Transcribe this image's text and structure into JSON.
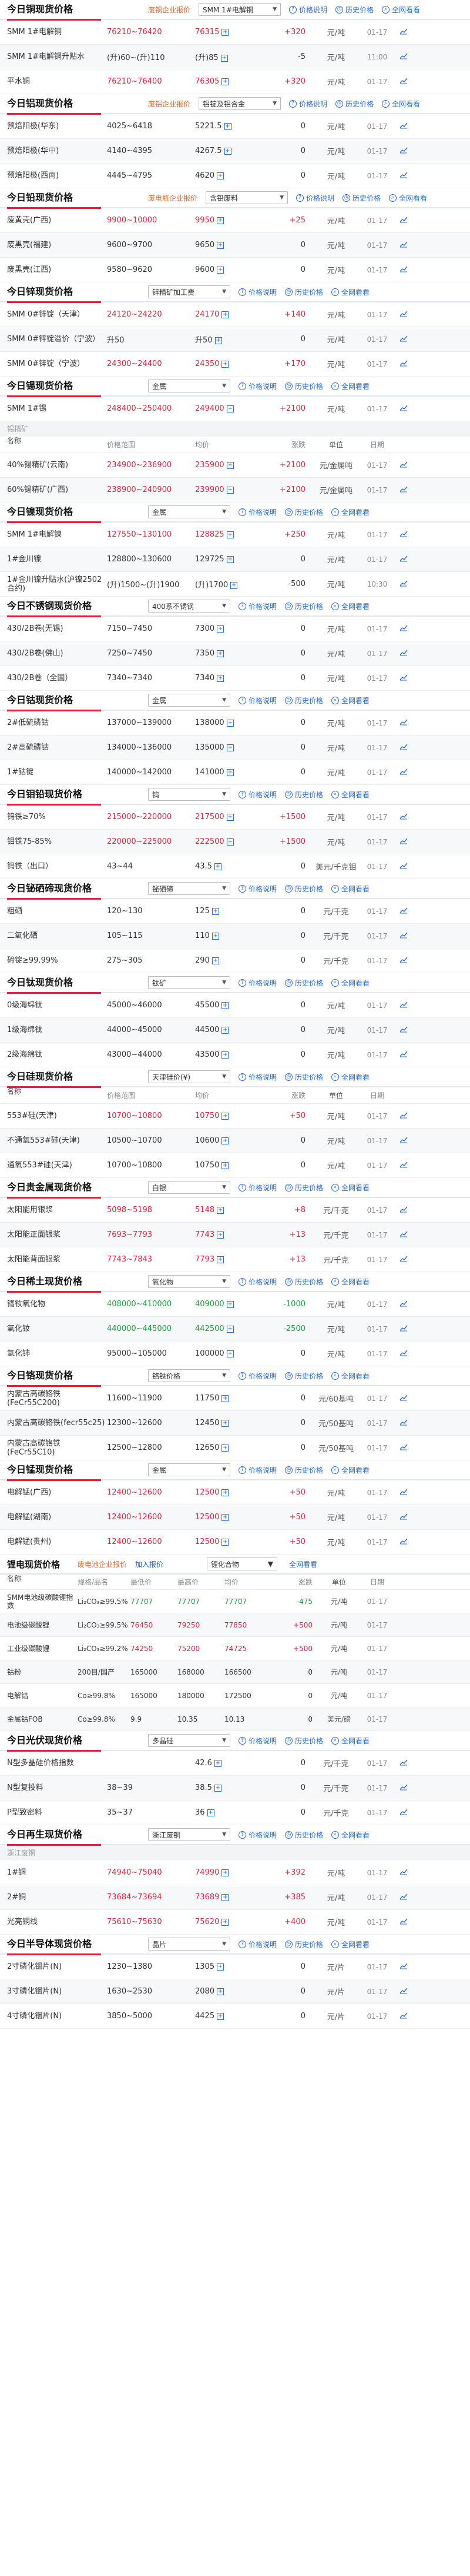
{
  "common": {
    "price_note": "价格说明",
    "history": "历史价格",
    "subscribe": "全网看看",
    "yuan_ton": "元/吨",
    "yuan_kg": "元/千克",
    "yuan_lv": "元/吨度",
    "usd_ton_kg": "美元/千克",
    "cols": {
      "name": "名称",
      "range": "价格范围",
      "avg": "均价",
      "chg": "涨跌",
      "unit": "单位",
      "date": "日期"
    }
  },
  "colors": {
    "accent": "#d7263d",
    "up": "#d7263d",
    "down": "#1a9c3e",
    "link": "#2a6bd6",
    "tag": "#e06a2c"
  },
  "sections": [
    {
      "title": "今日铜现货价格",
      "tag": "废铜企业报价",
      "select": "SMM 1#电解铜",
      "rows": [
        {
          "name": "SMM 1#电解铜",
          "range": "76210~76420",
          "avg": "76315",
          "chg": "+320",
          "dir": "up",
          "unit": "元/吨",
          "date": "01-17"
        },
        {
          "name": "SMM 1#电解铜升贴水",
          "range": "(升)60~(升)110",
          "avg": "(升)85",
          "chg": "-5",
          "dir": "none",
          "unit": "元/吨",
          "date": "11:00"
        },
        {
          "name": "平水铜",
          "range": "76210~76400",
          "avg": "76305",
          "chg": "+320",
          "dir": "up",
          "unit": "元/吨",
          "date": "01-17"
        }
      ]
    },
    {
      "title": "今日铝现货价格",
      "tag": "废铝企业报价",
      "select": "铝锭及铝合金",
      "rows": [
        {
          "name": "预焙阳极(华东)",
          "range": "4025~6418",
          "avg": "5221.5",
          "chg": "0",
          "dir": "none",
          "unit": "元/吨",
          "date": "01-17"
        },
        {
          "name": "预焙阳极(华中)",
          "range": "4140~4395",
          "avg": "4267.5",
          "chg": "0",
          "dir": "none",
          "unit": "元/吨",
          "date": "01-17"
        },
        {
          "name": "预焙阳极(西南)",
          "range": "4445~4795",
          "avg": "4620",
          "chg": "0",
          "dir": "none",
          "unit": "元/吨",
          "date": "01-17"
        }
      ]
    },
    {
      "title": "今日铅现货价格",
      "tag": "废电瓶企业报价",
      "select": "含铅废料",
      "rows": [
        {
          "name": "废黄壳(广西)",
          "range": "9900~10000",
          "avg": "9950",
          "chg": "+25",
          "dir": "up",
          "unit": "元/吨",
          "date": "01-17"
        },
        {
          "name": "废黑壳(福建)",
          "range": "9600~9700",
          "avg": "9650",
          "chg": "0",
          "dir": "none",
          "unit": "元/吨",
          "date": "01-17"
        },
        {
          "name": "废黑壳(江西)",
          "range": "9580~9620",
          "avg": "9600",
          "chg": "0",
          "dir": "none",
          "unit": "元/吨",
          "date": "01-17"
        }
      ]
    },
    {
      "title": "今日锌现货价格",
      "tag": "",
      "select": "锌精矿加工费",
      "rows": [
        {
          "name": "SMM 0#锌锭（天津）",
          "range": "24120~24220",
          "avg": "24170",
          "chg": "+140",
          "dir": "up",
          "unit": "元/吨",
          "date": "01-17"
        },
        {
          "name": "SMM 0#锌锭溢价（宁波）",
          "range": "升50",
          "avg": "升50",
          "chg": "0",
          "dir": "none",
          "unit": "元/吨",
          "date": "01-17"
        },
        {
          "name": "SMM 0#锌锭（宁波）",
          "range": "24300~24400",
          "avg": "24350",
          "chg": "+170",
          "dir": "up",
          "unit": "元/吨",
          "date": "01-17"
        }
      ]
    },
    {
      "title": "今日锡现货价格",
      "tag": "",
      "select": "金属",
      "rows": [
        {
          "name": "SMM 1#锡",
          "range": "248400~250400",
          "avg": "249400",
          "chg": "+2100",
          "dir": "up",
          "unit": "元/吨",
          "date": "01-17"
        }
      ],
      "subhead": "锡精矿",
      "rows2": [
        {
          "name": "40%锡精矿(云南)",
          "range": "234900~236900",
          "avg": "235900",
          "chg": "+2100",
          "dir": "up",
          "unit": "元/金属吨",
          "date": "01-17"
        },
        {
          "name": "60%锡精矿(广西)",
          "range": "238900~240900",
          "avg": "239900",
          "chg": "+2100",
          "dir": "up",
          "unit": "元/金属吨",
          "date": "01-17"
        }
      ]
    },
    {
      "title": "今日镍现货价格",
      "tag": "",
      "select": "金属",
      "rows": [
        {
          "name": "SMM 1#电解镍",
          "range": "127550~130100",
          "avg": "128825",
          "chg": "+250",
          "dir": "up",
          "unit": "元/吨",
          "date": "01-17"
        },
        {
          "name": "1#金川镍",
          "range": "128800~130600",
          "avg": "129725",
          "chg": "0",
          "dir": "none",
          "unit": "元/吨",
          "date": "01-17"
        },
        {
          "name": "1#金川镍升贴水(沪镍2502合约)",
          "range": "(升)1500~(升)1900",
          "avg": "(升)1700",
          "chg": "-500",
          "dir": "none",
          "unit": "元/吨",
          "date": "10:30"
        }
      ]
    },
    {
      "title": "今日不锈钢现货价格",
      "tag": "",
      "select": "400系不锈钢",
      "rows": [
        {
          "name": "430/2B卷(无锡)",
          "range": "7150~7450",
          "avg": "7300",
          "chg": "0",
          "dir": "none",
          "unit": "元/吨",
          "date": "01-17"
        },
        {
          "name": "430/2B卷(佛山)",
          "range": "7250~7450",
          "avg": "7350",
          "chg": "0",
          "dir": "none",
          "unit": "元/吨",
          "date": "01-17"
        },
        {
          "name": "430/2B卷（全国）",
          "range": "7340~7340",
          "avg": "7340",
          "chg": "0",
          "dir": "none",
          "unit": "元/吨",
          "date": "01-17"
        }
      ]
    },
    {
      "title": "今日钴现货价格",
      "tag": "",
      "select": "金属",
      "rows": [
        {
          "name": "2#低硫磷钴",
          "range": "137000~139000",
          "avg": "138000",
          "chg": "0",
          "dir": "none",
          "unit": "元/吨",
          "date": "01-17"
        },
        {
          "name": "2#高硫磷钴",
          "range": "134000~136000",
          "avg": "135000",
          "chg": "0",
          "dir": "none",
          "unit": "元/吨",
          "date": "01-17"
        },
        {
          "name": "1#钴锭",
          "range": "140000~142000",
          "avg": "141000",
          "chg": "0",
          "dir": "none",
          "unit": "元/吨",
          "date": "01-17"
        }
      ]
    },
    {
      "title": "今日钼铅现货价格",
      "tag": "",
      "select": "钨",
      "rows": [
        {
          "name": "钨铁≥70%",
          "range": "215000~220000",
          "avg": "217500",
          "chg": "+1500",
          "dir": "up",
          "unit": "元/吨",
          "date": "01-17"
        },
        {
          "name": "钼铁75-85%",
          "range": "220000~225000",
          "avg": "222500",
          "chg": "+1500",
          "dir": "up",
          "unit": "元/吨",
          "date": "01-17"
        },
        {
          "name": "钨铁（出口）",
          "range": "43~44",
          "avg": "43.5",
          "chg": "0",
          "dir": "none",
          "unit": "美元/千克钼",
          "date": "01-17"
        }
      ]
    },
    {
      "title": "今日铋硒碲现货价格",
      "tag": "",
      "select": "铋硒碲",
      "rows": [
        {
          "name": "粗硒",
          "range": "120~130",
          "avg": "125",
          "chg": "0",
          "dir": "none",
          "unit": "元/千克",
          "date": "01-17"
        },
        {
          "name": "二氧化硒",
          "range": "105~115",
          "avg": "110",
          "chg": "0",
          "dir": "none",
          "unit": "元/千克",
          "date": "01-17"
        },
        {
          "name": "碲锭≥99.99%",
          "range": "275~305",
          "avg": "290",
          "chg": "0",
          "dir": "none",
          "unit": "元/千克",
          "date": "01-17"
        }
      ]
    },
    {
      "title": "今日钛现货价格",
      "tag": "",
      "select": "钛矿",
      "rows": [
        {
          "name": "0级海绵钛",
          "range": "45000~46000",
          "avg": "45500",
          "chg": "0",
          "dir": "none",
          "unit": "元/吨",
          "date": "01-17"
        },
        {
          "name": "1级海绵钛",
          "range": "44000~45000",
          "avg": "44500",
          "chg": "0",
          "dir": "none",
          "unit": "元/吨",
          "date": "01-17"
        },
        {
          "name": "2级海绵钛",
          "range": "43000~44000",
          "avg": "43500",
          "chg": "0",
          "dir": "none",
          "unit": "元/吨",
          "date": "01-17"
        }
      ]
    },
    {
      "title": "今日硅现货价格",
      "tag": "",
      "select": "天津硅价(¥)",
      "rows": [
        {
          "name": "553#硅(天津)",
          "range": "10700~10800",
          "avg": "10750",
          "chg": "+50",
          "dir": "up",
          "unit": "元/吨",
          "date": "01-17"
        },
        {
          "name": "不通氧553#硅(天津)",
          "range": "10500~10700",
          "avg": "10600",
          "chg": "0",
          "dir": "none",
          "unit": "元/吨",
          "date": "01-17"
        },
        {
          "name": "通氧553#硅(天津)",
          "range": "10700~10800",
          "avg": "10750",
          "chg": "0",
          "dir": "none",
          "unit": "元/吨",
          "date": "01-17"
        }
      ],
      "with_colhead": true
    },
    {
      "title": "今日贵金属现货价格",
      "tag": "",
      "select": "白银",
      "rows": [
        {
          "name": "太阳能用银浆",
          "range": "5098~5198",
          "avg": "5148",
          "chg": "+8",
          "dir": "up",
          "unit": "元/千克",
          "date": "01-17"
        },
        {
          "name": "太阳能正面银浆",
          "range": "7693~7793",
          "avg": "7743",
          "chg": "+13",
          "dir": "up",
          "unit": "元/千克",
          "date": "01-17"
        },
        {
          "name": "太阳能背面银浆",
          "range": "7743~7843",
          "avg": "7793",
          "chg": "+13",
          "dir": "up",
          "unit": "元/千克",
          "date": "01-17"
        }
      ]
    },
    {
      "title": "今日稀土现货价格",
      "tag": "",
      "select": "氧化物",
      "rows": [
        {
          "name": "镨钕氧化物",
          "range": "408000~410000",
          "avg": "409000",
          "chg": "-1000",
          "dir": "down",
          "unit": "元/吨",
          "date": "01-17"
        },
        {
          "name": "氧化钕",
          "range": "440000~445000",
          "avg": "442500",
          "chg": "-2500",
          "dir": "down",
          "unit": "元/吨",
          "date": "01-17"
        },
        {
          "name": "氧化铈",
          "range": "95000~105000",
          "avg": "100000",
          "chg": "0",
          "dir": "none",
          "unit": "元/吨",
          "date": "01-17"
        }
      ]
    },
    {
      "title": "今日铬现货价格",
      "tag": "",
      "select": "铬铁价格",
      "rows": [
        {
          "name": "内蒙古高碳铬铁(FeCr55C200)",
          "range": "11600~11900",
          "avg": "11750",
          "chg": "0",
          "dir": "none",
          "unit": "元/60基吨",
          "date": "01-17"
        },
        {
          "name": "内蒙古高碳铬铁(fecr55c25)",
          "range": "12300~12600",
          "avg": "12450",
          "chg": "0",
          "dir": "none",
          "unit": "元/50基吨",
          "date": "01-17"
        },
        {
          "name": "内蒙古高碳铬铁(FeCr55C10)",
          "range": "12500~12800",
          "avg": "12650",
          "chg": "0",
          "dir": "none",
          "unit": "元/50基吨",
          "date": "01-17"
        }
      ]
    },
    {
      "title": "今日锰现货价格",
      "tag": "",
      "select": "金属",
      "rows": [
        {
          "name": "电解锰(广西)",
          "range": "12400~12600",
          "avg": "12500",
          "chg": "+50",
          "dir": "up",
          "unit": "元/吨",
          "date": "01-17"
        },
        {
          "name": "电解锰(湖南)",
          "range": "12400~12600",
          "avg": "12500",
          "chg": "+50",
          "dir": "up",
          "unit": "元/吨",
          "date": "01-17"
        },
        {
          "name": "电解锰(贵州)",
          "range": "12400~12600",
          "avg": "12500",
          "chg": "+50",
          "dir": "up",
          "unit": "元/吨",
          "date": "01-17"
        }
      ]
    }
  ],
  "lithium": {
    "title": "锂电现货价格",
    "tab1": "废电池企业报价",
    "tab2": "加入报价",
    "select": "锂化合物",
    "search": "全网看看",
    "cols": [
      "名称",
      "规格/品名",
      "最低价",
      "最高价",
      "均价",
      "涨跌",
      "单位",
      "日期"
    ],
    "rows": [
      {
        "name": "SMM电池级碳酸锂指数",
        "spec": "Li₂CO₃≥99.5%",
        "low": "77707",
        "high": "77707",
        "avg": "77707",
        "chg": "-475",
        "dir": "down",
        "unit": "元/吨",
        "date": "01-17"
      },
      {
        "name": "电池级碳酸锂",
        "spec": "Li₂CO₃≥99.5%",
        "low": "76450",
        "high": "79250",
        "avg": "77850",
        "chg": "+500",
        "dir": "up",
        "unit": "元/吨",
        "date": "01-17"
      },
      {
        "name": "工业级碳酸锂",
        "spec": "Li₂CO₃≥99.2%",
        "low": "74250",
        "high": "75200",
        "avg": "74725",
        "chg": "+500",
        "dir": "up",
        "unit": "元/吨",
        "date": "01-17"
      },
      {
        "name": "钴粉",
        "spec": "200目/国产",
        "low": "165000",
        "high": "168000",
        "avg": "166500",
        "chg": "0",
        "dir": "none",
        "unit": "元/吨",
        "date": "01-17"
      },
      {
        "name": "电解钴",
        "spec": "Co≥99.8%",
        "low": "165000",
        "high": "180000",
        "avg": "172500",
        "chg": "0",
        "dir": "none",
        "unit": "元/吨",
        "date": "01-17"
      },
      {
        "name": "金属钴FOB",
        "spec": "Co≥99.8%",
        "low": "9.9",
        "high": "10.35",
        "avg": "10.13",
        "chg": "0",
        "dir": "none",
        "unit": "美元/磅",
        "date": "01-17"
      }
    ]
  },
  "tail_sections": [
    {
      "title": "今日光伏现货价格",
      "tag": "",
      "select": "多晶硅",
      "rows": [
        {
          "name": "N型多晶硅价格指数",
          "range": "",
          "avg": "42.6",
          "chg": "0",
          "dir": "none",
          "unit": "元/千克",
          "date": "01-17"
        },
        {
          "name": "N型复投料",
          "range": "38~39",
          "avg": "38.5",
          "chg": "0",
          "dir": "none",
          "unit": "元/千克",
          "date": "01-17"
        },
        {
          "name": "P型致密料",
          "range": "35~37",
          "avg": "36",
          "chg": "0",
          "dir": "none",
          "unit": "元/千克",
          "date": "01-17"
        }
      ]
    },
    {
      "title": "今日再生现货价格",
      "tag": "",
      "select": "浙江废铜",
      "subhead": "浙江废铜",
      "rows": [
        {
          "name": "1#铜",
          "range": "74940~75040",
          "avg": "74990",
          "chg": "+392",
          "dir": "up",
          "unit": "元/吨",
          "date": "01-17"
        },
        {
          "name": "2#铜",
          "range": "73684~73694",
          "avg": "73689",
          "chg": "+385",
          "dir": "up",
          "unit": "元/吨",
          "date": "01-17"
        },
        {
          "name": "光亮铜线",
          "range": "75610~75630",
          "avg": "75620",
          "chg": "+400",
          "dir": "up",
          "unit": "元/吨",
          "date": "01-17"
        }
      ]
    },
    {
      "title": "今日半导体现货价格",
      "tag": "",
      "select": "晶片",
      "rows": [
        {
          "name": "2寸磷化铟片(N)",
          "range": "1230~1380",
          "avg": "1305",
          "chg": "0",
          "dir": "none",
          "unit": "元/片",
          "date": "01-17"
        },
        {
          "name": "3寸磷化铟片(N)",
          "range": "1630~2530",
          "avg": "2080",
          "chg": "0",
          "dir": "none",
          "unit": "元/片",
          "date": "01-17"
        },
        {
          "name": "4寸磷化铟片(N)",
          "range": "3850~5000",
          "avg": "4425",
          "chg": "0",
          "dir": "none",
          "unit": "元/片",
          "date": "01-17"
        }
      ]
    }
  ]
}
